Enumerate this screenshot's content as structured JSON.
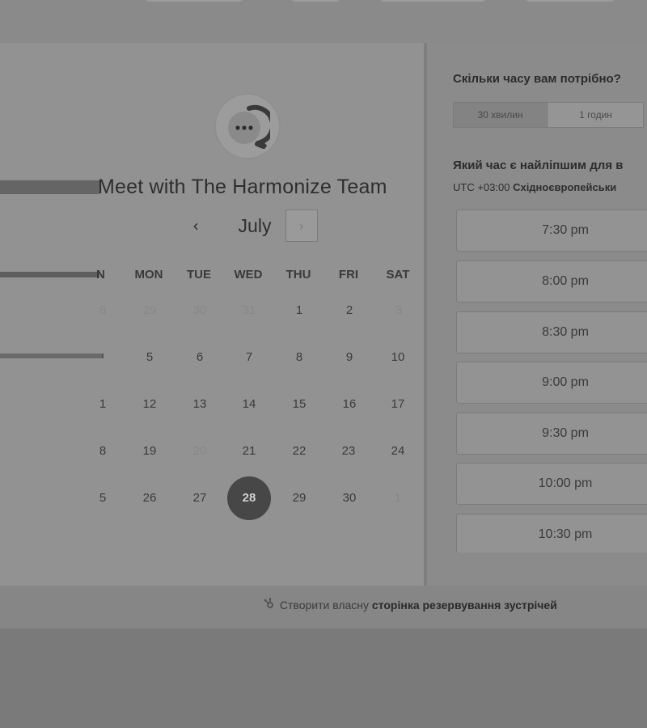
{
  "event": {
    "title": "Meet with The Harmonize Team"
  },
  "calendar": {
    "month": "July",
    "prev_icon": "‹",
    "next_icon": "›",
    "weekday_partial": "N",
    "weekdays": [
      "MON",
      "TUE",
      "WED",
      "THU",
      "FRI",
      "SAT"
    ],
    "first_column_partial": [
      "8",
      "",
      "1",
      "8",
      "5"
    ],
    "weeks": [
      [
        "29",
        "30",
        "31",
        "1",
        "2",
        "3"
      ],
      [
        "5",
        "6",
        "7",
        "8",
        "9",
        "10"
      ],
      [
        "12",
        "13",
        "14",
        "15",
        "16",
        "17"
      ],
      [
        "19",
        "20",
        "21",
        "22",
        "23",
        "24"
      ],
      [
        "26",
        "27",
        "28",
        "29",
        "30",
        "1"
      ]
    ],
    "selected_day": "28"
  },
  "duration": {
    "question": "Скільки часу вам потрібно?",
    "options": [
      "30 хвилин",
      "1 годин"
    ],
    "selected": "30 хвилин"
  },
  "time": {
    "question": "Який час є найліпшим для в",
    "timezone_offset": "UTC +03:00",
    "timezone_name": "Східноєвропейськи",
    "slots": [
      "7:30 pm",
      "8:00 pm",
      "8:30 pm",
      "9:00 pm",
      "9:30 pm",
      "10:00 pm",
      "10:30 pm"
    ]
  },
  "footer": {
    "prefix": "Створити власну",
    "link": "сторінка резервування зустрічей"
  },
  "icons": {
    "avatar": "chat-bubble-icon",
    "footer": "sprocket-icon"
  }
}
